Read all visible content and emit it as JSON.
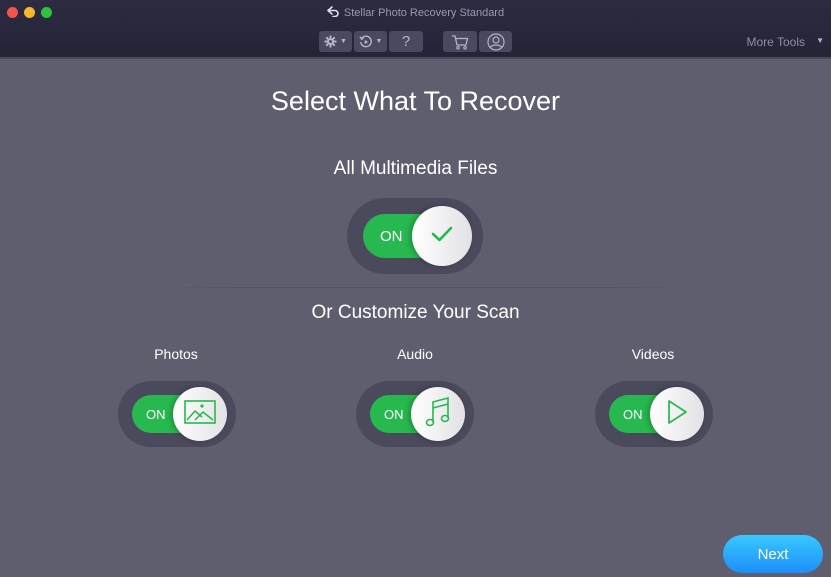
{
  "window": {
    "title": "Stellar Photo Recovery Standard",
    "back_icon": "back-arrow-icon"
  },
  "toolbar": {
    "settings_icon": "gear-icon",
    "recovery_icon": "history-icon",
    "help_label": "?",
    "cart_icon": "cart-icon",
    "account_icon": "user-icon",
    "more_tools_label": "More Tools",
    "more_tools_caret": "▼",
    "caret": "▼"
  },
  "main": {
    "title": "Select What To Recover",
    "all_multimedia": {
      "label": "All Multimedia Files",
      "state": "ON",
      "icon": "checkmark-icon"
    },
    "customize_heading": "Or Customize Your Scan",
    "categories": [
      {
        "label": "Photos",
        "state": "ON",
        "icon": "image-icon"
      },
      {
        "label": "Audio",
        "state": "ON",
        "icon": "music-note-icon"
      },
      {
        "label": "Videos",
        "state": "ON",
        "icon": "play-icon"
      }
    ],
    "next_label": "Next"
  },
  "colors": {
    "accent_green": "#27b84f",
    "next_blue": "#1c8ff7",
    "background": "#5f5e6e"
  }
}
